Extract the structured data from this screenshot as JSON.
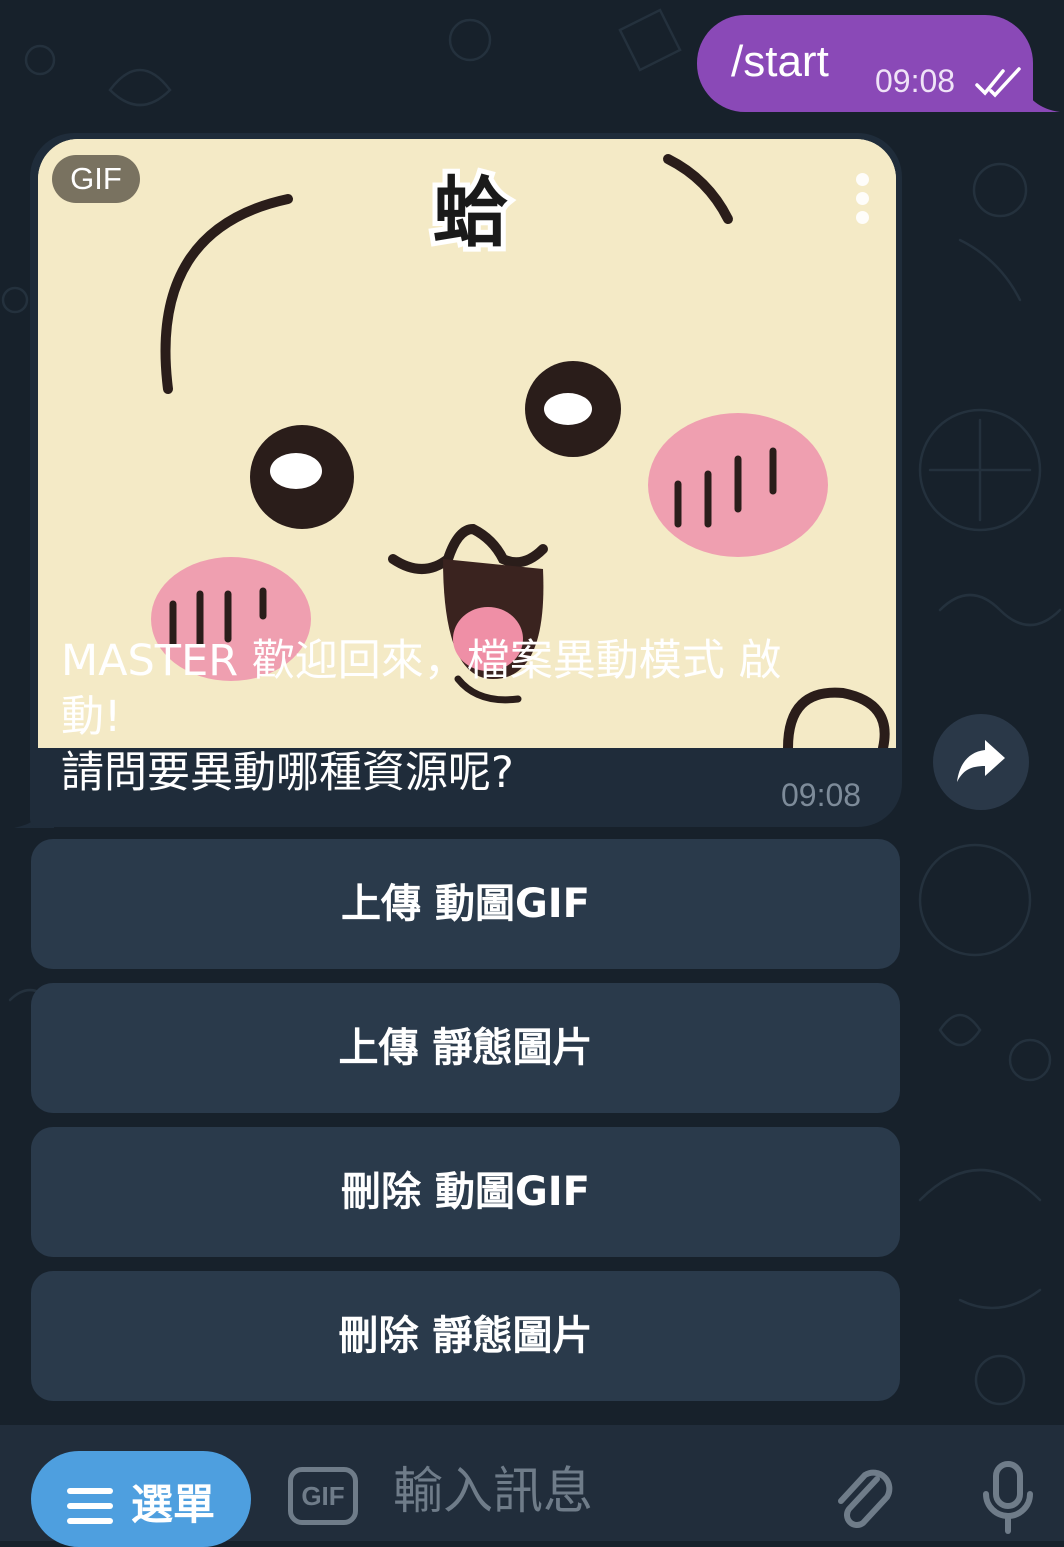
{
  "outgoing": {
    "text": "/start",
    "time": "09:08",
    "status_icon": "double-check-icon"
  },
  "incoming": {
    "media_badge": "GIF",
    "sticker_text": "蛤",
    "caption_lines": [
      "MASTER 歡迎回來，檔案異動模式 啟",
      "動!",
      "請問要異動哪種資源呢?"
    ],
    "time": "09:08",
    "share_icon": "share-arrow-icon"
  },
  "keyboard": [
    {
      "label": "上傳 動圖GIF"
    },
    {
      "label": "上傳 靜態圖片"
    },
    {
      "label": "刪除 動圖GIF"
    },
    {
      "label": "刪除 靜態圖片"
    }
  ],
  "composer": {
    "menu_label": "選單",
    "gif_label": "GIF",
    "placeholder": "輸入訊息",
    "attach_icon": "paperclip-icon",
    "mic_icon": "microphone-icon"
  },
  "colors": {
    "background": "#17212b",
    "outgoing_bubble": "#8a49b7",
    "incoming_bubble": "#1f2c3a",
    "keyboard_button": "#2a3a4b",
    "menu_button": "#4e9fdf"
  }
}
